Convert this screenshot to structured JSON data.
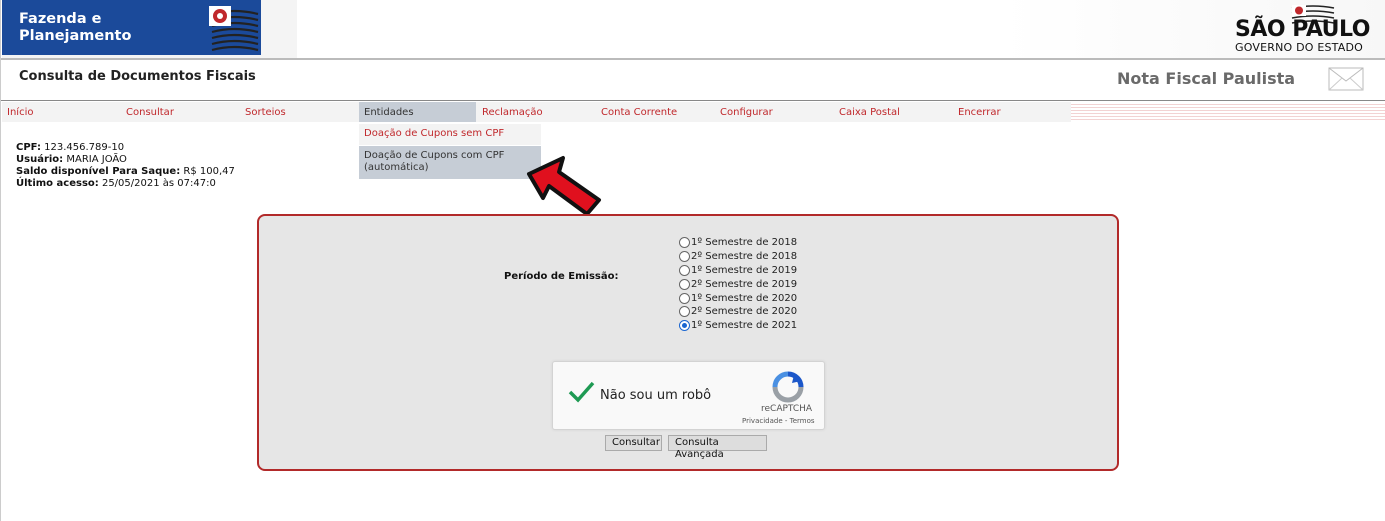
{
  "header": {
    "brand_line1": "Fazenda e",
    "brand_line2": "Planejamento",
    "sp_title": "SÃO PAULO",
    "sp_subtitle": "GOVERNO DO ESTADO",
    "page_subtitle": "Consulta de Documentos Fiscais",
    "app_title": "Nota Fiscal Paulista"
  },
  "nav": {
    "items": [
      {
        "label": "Início"
      },
      {
        "label": "Consultar"
      },
      {
        "label": "Sorteios"
      },
      {
        "label": "Entidades"
      },
      {
        "label": "Reclamação"
      },
      {
        "label": "Conta Corrente"
      },
      {
        "label": "Configurar"
      },
      {
        "label": "Caixa Postal"
      },
      {
        "label": "Encerrar"
      }
    ],
    "active": "Entidades",
    "dropdown": [
      {
        "label": "Doação de Cupons sem CPF"
      },
      {
        "label": "Doação de Cupons com CPF (automática)"
      }
    ]
  },
  "user": {
    "cpf_label": "CPF:",
    "cpf": "123.456.789-10",
    "usuario_label": "Usuário:",
    "usuario": "MARIA JOÃO",
    "saldo_label": "Saldo disponível Para Saque:",
    "saldo": "R$ 100,47",
    "acesso_label": "Último acesso:",
    "acesso": "25/05/2021 às 07:47:0"
  },
  "form": {
    "periodo_label": "Período de Emissão:",
    "options": [
      {
        "label": "1º Semestre de 2018",
        "checked": false
      },
      {
        "label": "2º Semestre de 2018",
        "checked": false
      },
      {
        "label": "1º Semestre de 2019",
        "checked": false
      },
      {
        "label": "2º Semestre de 2019",
        "checked": false
      },
      {
        "label": "1º Semestre de 2020",
        "checked": false
      },
      {
        "label": "2º Semestre de 2020",
        "checked": false
      },
      {
        "label": "1º Semestre de 2021",
        "checked": true
      }
    ],
    "captcha": {
      "label": "Não sou um robô",
      "brand": "reCAPTCHA",
      "links": "Privacidade - Termos"
    },
    "consultar_label": "Consultar",
    "avancada_label": "Consulta Avançada"
  },
  "colors": {
    "brand_blue": "#1b4a9a",
    "nav_red": "#c0282c",
    "panel_border": "#b22a2a",
    "arrow_red": "#e0101e"
  }
}
